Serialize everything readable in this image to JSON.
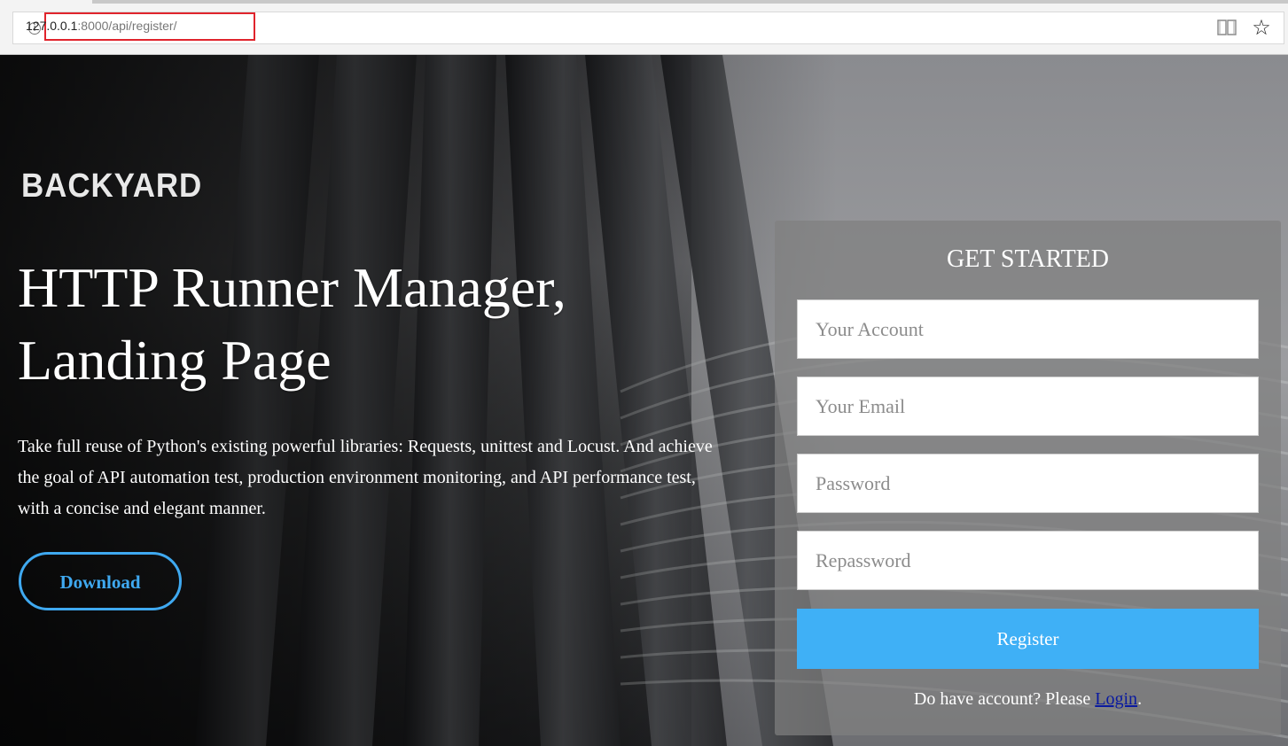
{
  "browser": {
    "url_host": "127.0.0.1",
    "url_rest": ":8000/api/register/"
  },
  "brand": {
    "logo_text": "BACKYARD"
  },
  "hero": {
    "headline_line1": "HTTP Runner Manager,",
    "headline_line2": "Landing Page",
    "description": "Take full reuse of Python's existing powerful libraries: Requests, unittest and Locust. And achieve the goal of API automation test, production environment monitoring, and API performance test, with a concise and elegant manner.",
    "download_label": "Download"
  },
  "form": {
    "title": "GET STARTED",
    "account_placeholder": "Your Account",
    "email_placeholder": "Your Email",
    "password_placeholder": "Password",
    "repassword_placeholder": "Repassword",
    "register_label": "Register",
    "login_prompt": "Do have account? Please ",
    "login_link": "Login",
    "login_suffix": "."
  },
  "colors": {
    "accent": "#3fb0f6",
    "url_highlight": "#e0242c",
    "link": "#0a1aa0"
  }
}
